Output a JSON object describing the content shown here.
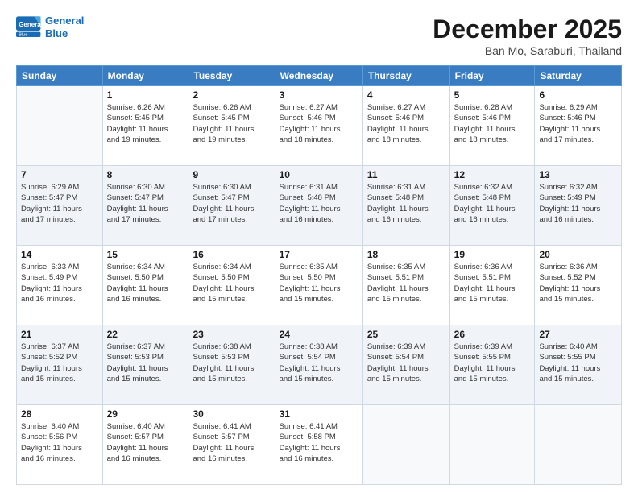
{
  "logo": {
    "line1": "General",
    "line2": "Blue"
  },
  "title": "December 2025",
  "subtitle": "Ban Mo, Saraburi, Thailand",
  "days_of_week": [
    "Sunday",
    "Monday",
    "Tuesday",
    "Wednesday",
    "Thursday",
    "Friday",
    "Saturday"
  ],
  "weeks": [
    [
      {
        "day": "",
        "info": ""
      },
      {
        "day": "1",
        "info": "Sunrise: 6:26 AM\nSunset: 5:45 PM\nDaylight: 11 hours\nand 19 minutes."
      },
      {
        "day": "2",
        "info": "Sunrise: 6:26 AM\nSunset: 5:45 PM\nDaylight: 11 hours\nand 19 minutes."
      },
      {
        "day": "3",
        "info": "Sunrise: 6:27 AM\nSunset: 5:46 PM\nDaylight: 11 hours\nand 18 minutes."
      },
      {
        "day": "4",
        "info": "Sunrise: 6:27 AM\nSunset: 5:46 PM\nDaylight: 11 hours\nand 18 minutes."
      },
      {
        "day": "5",
        "info": "Sunrise: 6:28 AM\nSunset: 5:46 PM\nDaylight: 11 hours\nand 18 minutes."
      },
      {
        "day": "6",
        "info": "Sunrise: 6:29 AM\nSunset: 5:46 PM\nDaylight: 11 hours\nand 17 minutes."
      }
    ],
    [
      {
        "day": "7",
        "info": "Sunrise: 6:29 AM\nSunset: 5:47 PM\nDaylight: 11 hours\nand 17 minutes."
      },
      {
        "day": "8",
        "info": "Sunrise: 6:30 AM\nSunset: 5:47 PM\nDaylight: 11 hours\nand 17 minutes."
      },
      {
        "day": "9",
        "info": "Sunrise: 6:30 AM\nSunset: 5:47 PM\nDaylight: 11 hours\nand 17 minutes."
      },
      {
        "day": "10",
        "info": "Sunrise: 6:31 AM\nSunset: 5:48 PM\nDaylight: 11 hours\nand 16 minutes."
      },
      {
        "day": "11",
        "info": "Sunrise: 6:31 AM\nSunset: 5:48 PM\nDaylight: 11 hours\nand 16 minutes."
      },
      {
        "day": "12",
        "info": "Sunrise: 6:32 AM\nSunset: 5:48 PM\nDaylight: 11 hours\nand 16 minutes."
      },
      {
        "day": "13",
        "info": "Sunrise: 6:32 AM\nSunset: 5:49 PM\nDaylight: 11 hours\nand 16 minutes."
      }
    ],
    [
      {
        "day": "14",
        "info": "Sunrise: 6:33 AM\nSunset: 5:49 PM\nDaylight: 11 hours\nand 16 minutes."
      },
      {
        "day": "15",
        "info": "Sunrise: 6:34 AM\nSunset: 5:50 PM\nDaylight: 11 hours\nand 16 minutes."
      },
      {
        "day": "16",
        "info": "Sunrise: 6:34 AM\nSunset: 5:50 PM\nDaylight: 11 hours\nand 15 minutes."
      },
      {
        "day": "17",
        "info": "Sunrise: 6:35 AM\nSunset: 5:50 PM\nDaylight: 11 hours\nand 15 minutes."
      },
      {
        "day": "18",
        "info": "Sunrise: 6:35 AM\nSunset: 5:51 PM\nDaylight: 11 hours\nand 15 minutes."
      },
      {
        "day": "19",
        "info": "Sunrise: 6:36 AM\nSunset: 5:51 PM\nDaylight: 11 hours\nand 15 minutes."
      },
      {
        "day": "20",
        "info": "Sunrise: 6:36 AM\nSunset: 5:52 PM\nDaylight: 11 hours\nand 15 minutes."
      }
    ],
    [
      {
        "day": "21",
        "info": "Sunrise: 6:37 AM\nSunset: 5:52 PM\nDaylight: 11 hours\nand 15 minutes."
      },
      {
        "day": "22",
        "info": "Sunrise: 6:37 AM\nSunset: 5:53 PM\nDaylight: 11 hours\nand 15 minutes."
      },
      {
        "day": "23",
        "info": "Sunrise: 6:38 AM\nSunset: 5:53 PM\nDaylight: 11 hours\nand 15 minutes."
      },
      {
        "day": "24",
        "info": "Sunrise: 6:38 AM\nSunset: 5:54 PM\nDaylight: 11 hours\nand 15 minutes."
      },
      {
        "day": "25",
        "info": "Sunrise: 6:39 AM\nSunset: 5:54 PM\nDaylight: 11 hours\nand 15 minutes."
      },
      {
        "day": "26",
        "info": "Sunrise: 6:39 AM\nSunset: 5:55 PM\nDaylight: 11 hours\nand 15 minutes."
      },
      {
        "day": "27",
        "info": "Sunrise: 6:40 AM\nSunset: 5:55 PM\nDaylight: 11 hours\nand 15 minutes."
      }
    ],
    [
      {
        "day": "28",
        "info": "Sunrise: 6:40 AM\nSunset: 5:56 PM\nDaylight: 11 hours\nand 16 minutes."
      },
      {
        "day": "29",
        "info": "Sunrise: 6:40 AM\nSunset: 5:57 PM\nDaylight: 11 hours\nand 16 minutes."
      },
      {
        "day": "30",
        "info": "Sunrise: 6:41 AM\nSunset: 5:57 PM\nDaylight: 11 hours\nand 16 minutes."
      },
      {
        "day": "31",
        "info": "Sunrise: 6:41 AM\nSunset: 5:58 PM\nDaylight: 11 hours\nand 16 minutes."
      },
      {
        "day": "",
        "info": ""
      },
      {
        "day": "",
        "info": ""
      },
      {
        "day": "",
        "info": ""
      }
    ]
  ]
}
